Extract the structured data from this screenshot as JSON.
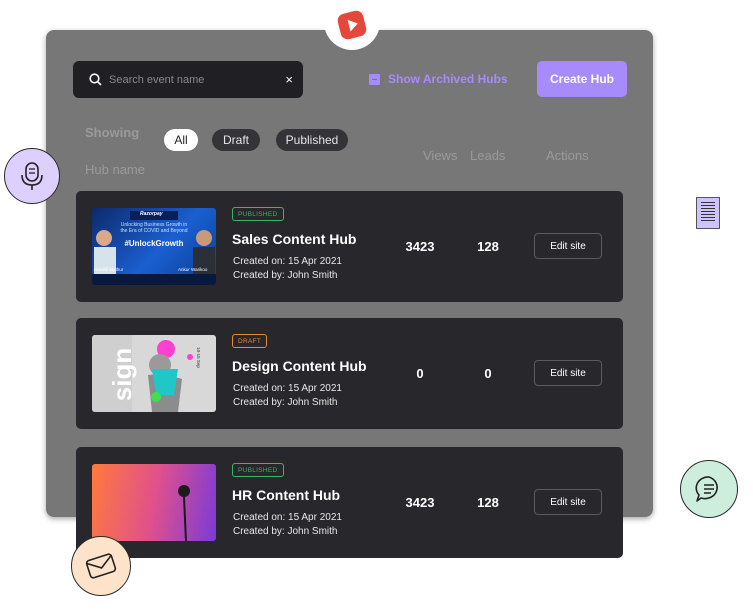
{
  "search": {
    "placeholder": "Search event name",
    "clear_label": "×"
  },
  "toolbar": {
    "archived_label": "Show Archived Hubs",
    "create_label": "Create Hub"
  },
  "filters": {
    "showing_label": "Showing",
    "chips": [
      "All",
      "Draft",
      "Published"
    ],
    "selected": "All"
  },
  "columns": {
    "hub_name": "Hub name",
    "views": "Views",
    "leads": "Leads",
    "actions": "Actions"
  },
  "hubs": [
    {
      "status": "PUBLISHED",
      "title": "Sales Content Hub",
      "created_on": "Created on: 15 Apr 2021",
      "created_by": "Created by: John Smith",
      "views": "3423",
      "leads": "128",
      "action": "Edit site",
      "thumb": {
        "brand": "Razorpay",
        "headline": "Unlocking Business Growth in the Era of COVID and Beyond",
        "hashtag": "#UnlockGrowth",
        "speaker1": "Harshil Mathur",
        "speaker2": "Ankur Warikoo"
      }
    },
    {
      "status": "DRAFT",
      "title": "Design Content Hub",
      "created_on": "Created on: 15 Apr 2021",
      "created_by": "Created by: John Smith",
      "views": "0",
      "leads": "0",
      "action": "Edit site",
      "thumb": {
        "text": "sign",
        "date": "10-15 Sep"
      }
    },
    {
      "status": "PUBLISHED",
      "title": "HR Content Hub",
      "created_on": "Created on: 15 Apr 2021",
      "created_by": "Created by: John Smith",
      "views": "3423",
      "leads": "128",
      "action": "Edit site"
    }
  ],
  "colors": {
    "accent": "#a78bfa",
    "published": "#3fb26a",
    "draft": "#e08a3a",
    "card": "#27272c",
    "panel": "#777777"
  },
  "icons": [
    "youtube-icon",
    "search-icon",
    "archive-icon",
    "microphone-icon",
    "document-icon",
    "chat-icon",
    "mail-icon"
  ]
}
